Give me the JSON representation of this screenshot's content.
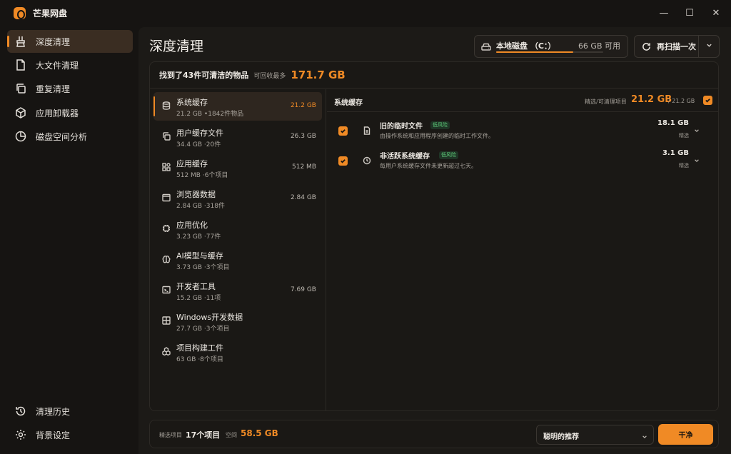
{
  "app": {
    "title": "芒果网盘"
  },
  "window": {
    "minimize": "—",
    "maximize": "☐",
    "close": "✕"
  },
  "sidebar": {
    "items": [
      {
        "label": "深度清理",
        "icon": "broom-icon",
        "active": true
      },
      {
        "label": "大文件清理",
        "icon": "file-icon"
      },
      {
        "label": "重复清理",
        "icon": "copy-icon"
      },
      {
        "label": "应用卸载器",
        "icon": "package-icon"
      },
      {
        "label": "磁盘空间分析",
        "icon": "pie-chart-icon"
      }
    ],
    "bottom_items": [
      {
        "label": "清理历史",
        "icon": "history-icon"
      },
      {
        "label": "背景设定",
        "icon": "gear-icon"
      }
    ]
  },
  "header": {
    "title": "深度清理",
    "disk": {
      "label": "本地磁盘 （C：）",
      "free": "66 GB 可用",
      "used_fraction": 0.72,
      "icon": "drive-icon"
    },
    "rescan": {
      "label": "再扫描一次",
      "icon": "refresh-icon",
      "dropdown_icon": "chevron-down-icon"
    }
  },
  "summary": {
    "found": "找到了43件可清洁的物品",
    "reclaim_label": "可回收最多",
    "reclaim_size": "171.7 GB"
  },
  "categories": [
    {
      "name": "系统缓存",
      "meta": "21.2 GB •1842件物品",
      "size": "21.2 GB",
      "active": true,
      "icon": "database-icon"
    },
    {
      "name": "用户缓存文件",
      "meta": "34.4 GB ·20件",
      "size": "26.3 GB",
      "icon": "copy-icon"
    },
    {
      "name": "应用缓存",
      "meta": "512 MB ·6个项目",
      "size": "512 MB",
      "icon": "grid-icon"
    },
    {
      "name": "浏览器数据",
      "meta": "2.84 GB ·318件",
      "size": "2.84 GB",
      "icon": "browser-icon"
    },
    {
      "name": "应用优化",
      "meta": "3.23 GB ·77件",
      "size": "",
      "icon": "chip-icon"
    },
    {
      "name": "AI模型与缓存",
      "meta": "3.73 GB ·3个项目",
      "size": "",
      "icon": "brain-icon"
    },
    {
      "name": "开发者工具",
      "meta": "15.2 GB ·11项",
      "size": "7.69 GB",
      "icon": "terminal-icon"
    },
    {
      "name": "Windows开发数据",
      "meta": "27.7 GB ·3个项目",
      "size": "",
      "icon": "windows-icon"
    },
    {
      "name": "项目构建工件",
      "meta": "63 GB ·8个项目",
      "size": "",
      "icon": "boxes-icon"
    }
  ],
  "detail": {
    "title": "系统缓存",
    "selected_label": "精选/可清理项目",
    "selected_size": "21.2 GB",
    "total": "/ 21.2 GB",
    "entries": [
      {
        "title": "旧的临时文件",
        "risk": "低风险",
        "desc": "由操作系统和应用程序创建的临时工作文件。",
        "size": "18.1 GB",
        "selected": "精选",
        "icon": "file-icon"
      },
      {
        "title": "非活跃系统缓存",
        "risk": "低风险",
        "desc": "每用户系统缓存文件未更新超过七天。",
        "size": "3.1 GB",
        "selected": "精选",
        "icon": "clock-icon"
      }
    ]
  },
  "footer": {
    "selected_label": "精选项目",
    "selected_count": "17个项目",
    "space_label": "空间",
    "space_value": "58.5 GB",
    "preset": "聪明的推荐",
    "clean_label": "干净"
  }
}
